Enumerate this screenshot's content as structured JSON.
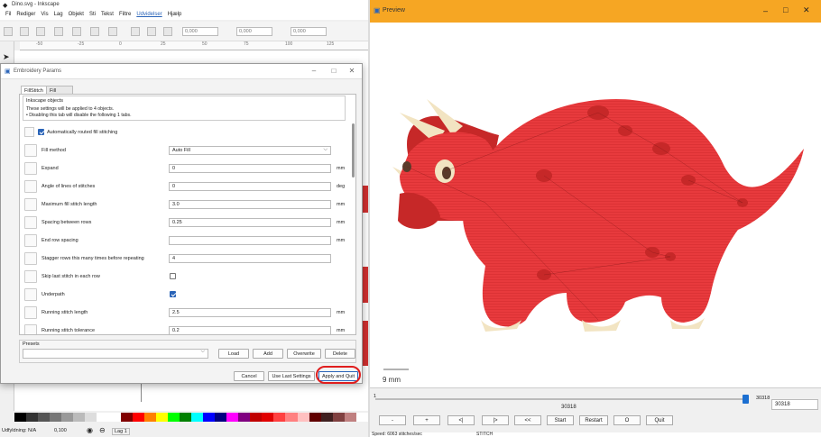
{
  "inkscape": {
    "title": "Dino.svg - Inkscape",
    "menu": [
      "Fil",
      "Rediger",
      "Vis",
      "Lag",
      "Objekt",
      "Sti",
      "Tekst",
      "Filtre",
      "Udvidelser",
      "Hjælp"
    ],
    "menu_active": "Udvidelser",
    "spin_values": [
      "0,000",
      "0,000",
      "0,000"
    ],
    "status_text": "Udfyldning: N/A",
    "status_values": [
      "0,100",
      "Lag 1"
    ],
    "ruler_marks": [
      "-50",
      "-25",
      "0",
      "25",
      "50",
      "75",
      "100",
      "125"
    ],
    "palette": [
      "#000000",
      "#333333",
      "#555555",
      "#777777",
      "#999999",
      "#bbbbbb",
      "#dddddd",
      "#ffffff",
      "#ffffff",
      "#800000",
      "#ff0000",
      "#ff8000",
      "#ffff00",
      "#00ff00",
      "#008000",
      "#00ffff",
      "#0000ff",
      "#000080",
      "#ff00ff",
      "#800080",
      "#c00000",
      "#e00000",
      "#ff4040",
      "#ff8080",
      "#ffc0c0",
      "#600000",
      "#402020",
      "#804040",
      "#c08080",
      "#ffffff"
    ]
  },
  "dialog": {
    "title": "Embroidery Params",
    "tabs": [
      "FillStitch",
      "Fill Underlay"
    ],
    "objects_label": "Inkscape objects",
    "objects_line1": "These settings will be applied to 4 objects.",
    "objects_line2": "• Disabling this tab will disable the following 1 tabs.",
    "auto_route_label": "Automatically routed fill stitching",
    "params": [
      {
        "name": "Fill method",
        "value": "Auto Fill",
        "unit": ""
      },
      {
        "name": "Expand",
        "value": "0",
        "unit": "mm"
      },
      {
        "name": "Angle of lines of stitches",
        "value": "0",
        "unit": "deg"
      },
      {
        "name": "Maximum fill stitch length",
        "value": "3.0",
        "unit": "mm"
      },
      {
        "name": "Spacing between rows",
        "value": "0.25",
        "unit": "mm"
      },
      {
        "name": "End row spacing",
        "value": "",
        "unit": "mm"
      },
      {
        "name": "Stagger rows this many times before repeating",
        "value": "4",
        "unit": ""
      },
      {
        "name": "Skip last stitch in each row",
        "value": "",
        "unit": ""
      },
      {
        "name": "Underpath",
        "value": "",
        "unit": ""
      },
      {
        "name": "Running stitch length",
        "value": "2.5",
        "unit": "mm"
      },
      {
        "name": "Running stitch tolerance",
        "value": "0.2",
        "unit": "mm"
      }
    ],
    "presets_label": "Presets",
    "preset_buttons": [
      "Load",
      "Add",
      "Overwrite",
      "Delete"
    ],
    "bottom_buttons": [
      "Cancel",
      "Use Last Settings",
      "Apply and Quit"
    ],
    "auto_route_checked": true,
    "skip_last_checked": false,
    "underpath_checked": true
  },
  "preview": {
    "title": "Preview",
    "scale_label": "9 mm",
    "slider_min": "1",
    "slider_value_label": "30318",
    "slider_max_label": "30318",
    "stitch_input": "30318",
    "slider_fraction": 0.99,
    "buttons": [
      "-",
      "+",
      "<|",
      "|>",
      "<<",
      "Start",
      "Restart",
      "O",
      "Quit"
    ],
    "status_speed": "Speed: 6063 stitches/sec",
    "status_cmd": "STITCH",
    "fill_color": "#e83a3d",
    "dark_color": "#c62828",
    "cream_color": "#f2e4c2"
  }
}
